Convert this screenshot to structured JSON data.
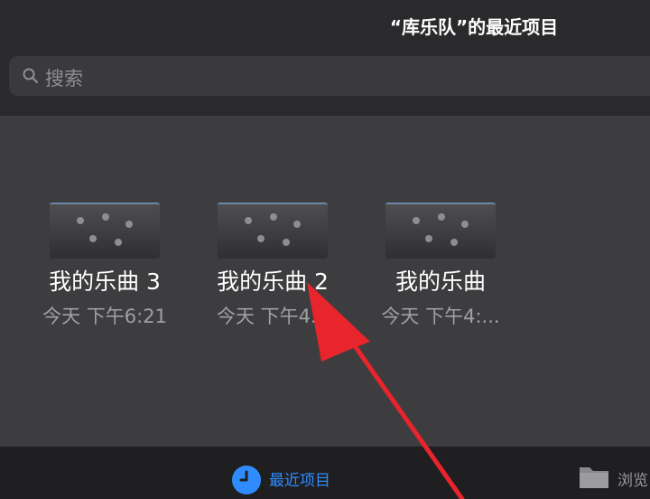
{
  "header": {
    "title": "“库乐队”的最近项目"
  },
  "search": {
    "label": "搜索",
    "icon": "search-icon"
  },
  "files": [
    {
      "name": "我的乐曲 3",
      "date": "今天 下午6:21"
    },
    {
      "name": "我的乐曲 2",
      "date": "今天 下午4..."
    },
    {
      "name": "我的乐曲",
      "date": "今天 下午4:..."
    }
  ],
  "tabbar": {
    "recent_label": "最近项目",
    "browse_label": "浏览",
    "accent": "#2f8cff"
  },
  "annotation": {
    "color": "#e8242c",
    "icon": "red-arrow"
  }
}
